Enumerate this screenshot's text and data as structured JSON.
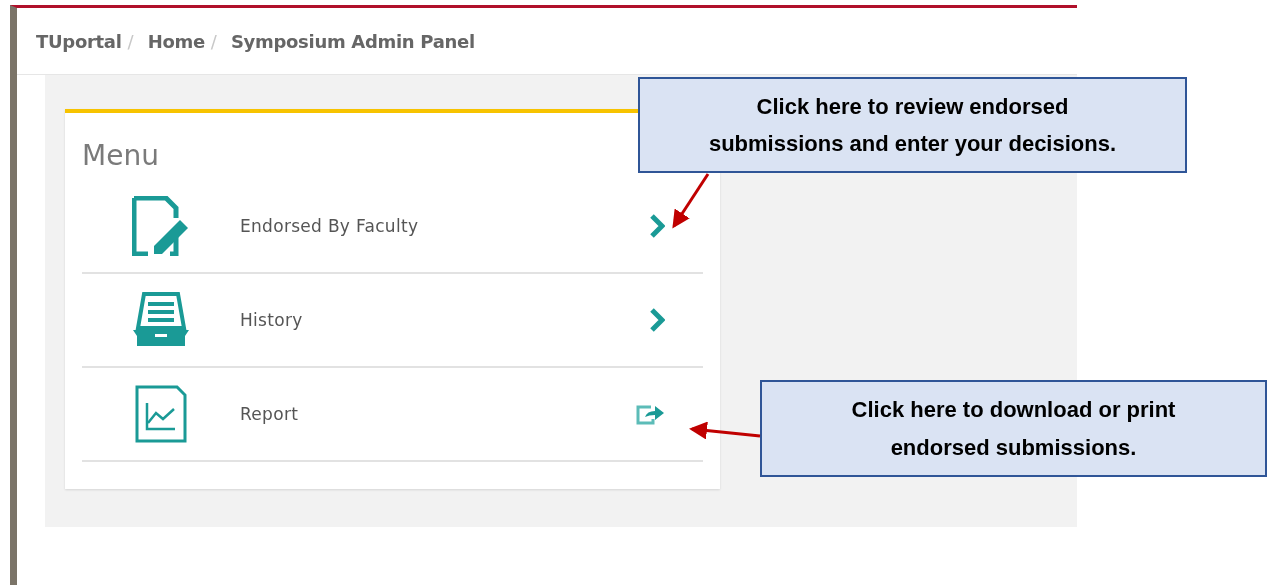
{
  "breadcrumb": [
    {
      "label": "TUportal",
      "separator": "/"
    },
    {
      "label": "Home",
      "separator": "/"
    },
    {
      "label": "Symposium Admin Panel"
    }
  ],
  "menu": {
    "title": "Menu",
    "items": [
      {
        "label": "Endorsed By Faculty"
      },
      {
        "label": "History"
      },
      {
        "label": "Report"
      }
    ]
  },
  "callouts": [
    {
      "text": "Click here to review endorsed\nsubmissions and enter your decisions."
    },
    {
      "text": "Click here to download or print\nendorsed submissions."
    }
  ]
}
